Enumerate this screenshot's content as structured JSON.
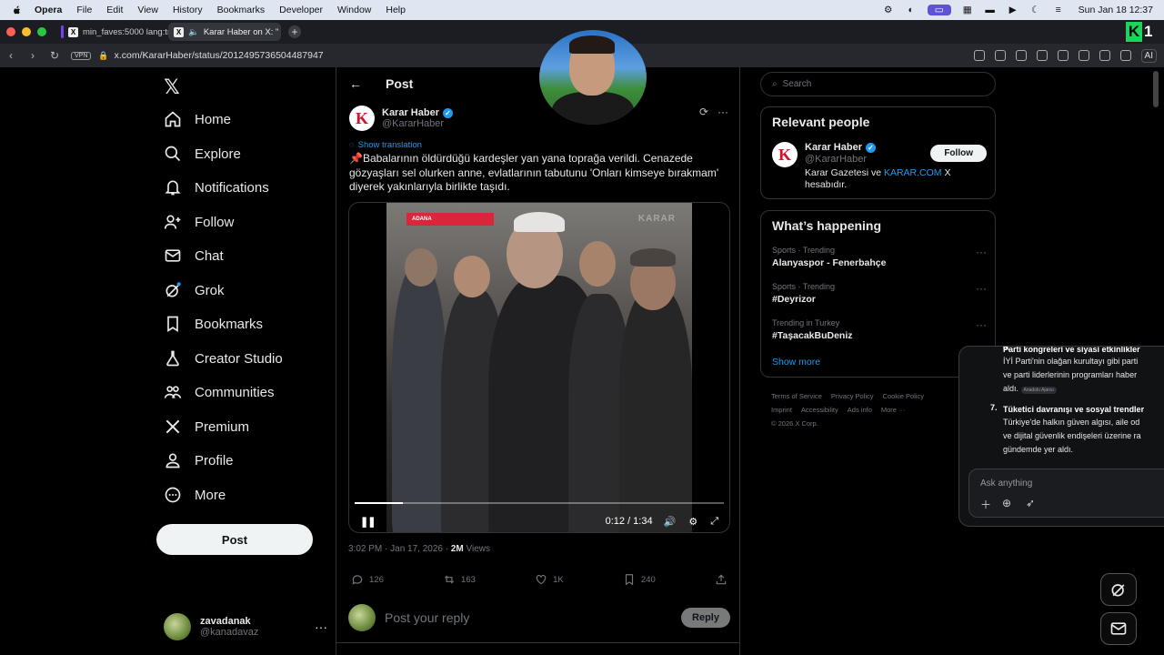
{
  "menubar": {
    "app": "Opera",
    "items": [
      "File",
      "Edit",
      "View",
      "History",
      "Bookmarks",
      "Developer",
      "Window",
      "Help"
    ],
    "clock": "Sun Jan 18  12:37"
  },
  "browser": {
    "tabs": [
      {
        "label": "min_faves:5000 lang:tr"
      },
      {
        "label": "Karar Haber on X: \""
      }
    ],
    "url": "x.com/KararHaber/status/2012495736504487947",
    "vpn": "VPN",
    "ai_label": "AI"
  },
  "nav": {
    "items": [
      {
        "label": "Home",
        "icon": "home-icon"
      },
      {
        "label": "Explore",
        "icon": "search-icon"
      },
      {
        "label": "Notifications",
        "icon": "bell-icon"
      },
      {
        "label": "Follow",
        "icon": "follow-icon"
      },
      {
        "label": "Chat",
        "icon": "mail-icon"
      },
      {
        "label": "Grok",
        "icon": "grok-icon"
      },
      {
        "label": "Bookmarks",
        "icon": "bookmark-icon"
      },
      {
        "label": "Creator Studio",
        "icon": "flask-icon"
      },
      {
        "label": "Communities",
        "icon": "communities-icon"
      },
      {
        "label": "Premium",
        "icon": "x-icon"
      },
      {
        "label": "Profile",
        "icon": "person-icon"
      },
      {
        "label": "More",
        "icon": "more-icon"
      }
    ],
    "post_button": "Post",
    "account": {
      "name": "zavadanak",
      "handle": "@kanadavaz"
    }
  },
  "post": {
    "header": "Post",
    "author_name": "Karar Haber",
    "author_handle": "@KararHaber",
    "show_translation": "Show translation",
    "text": "📌Babalarının öldürdüğü kardeşler yan yana toprağa verildi. Cenazede gözyaşları sel olurken anne, evlatlarının tabutunu 'Onları kimseye bırakmam' diyerek yakınlarıyla birlikte taşıdı.",
    "video": {
      "location_tag": "ADANA",
      "watermark": "KARAR",
      "time": "0:12 / 1:34",
      "progress": 0.13
    },
    "timestamp": "3:02 PM · Jan 17, 2026 · ",
    "views_count": "2M",
    "views_label": " Views",
    "stats": {
      "replies": "126",
      "reposts": "163",
      "likes": "1K",
      "bookmarks": "240"
    },
    "reply_placeholder": "Post your reply",
    "reply_button": "Reply"
  },
  "sidebar": {
    "search_placeholder": "Search",
    "relevant_title": "Relevant people",
    "relevant": {
      "name": "Karar Haber",
      "handle": "@KararHaber",
      "bio_pre": "Karar Gazetesi ve ",
      "bio_link": "KARAR.COM",
      "bio_post": " X hesabıdır.",
      "follow": "Follow"
    },
    "happening_title": "What’s happening",
    "trends": [
      {
        "category": "Sports · Trending",
        "title": "Alanyaspor - Fenerbahçe"
      },
      {
        "category": "Sports · Trending",
        "title": "#Deyrizor"
      },
      {
        "category": "Trending in Turkey",
        "title": "#TaşacakBuDeniz"
      }
    ],
    "show_more": "Show more",
    "footer": [
      "Terms of Service",
      "Privacy Policy",
      "Cookie Policy",
      "Imprint",
      "Accessibility",
      "Ads info",
      "More ···",
      "© 2026 X Corp."
    ]
  },
  "ai_panel": {
    "item6_title": "Parti kongreleri ve siyasi etkinlikler",
    "item6_lines": [
      "İYİ Parti'nin olağan kurultayı gibi parti",
      "ve parti liderlerinin programları haber",
      "aldı."
    ],
    "item6_source": "Anadolu Ajansı",
    "item7_num": "7.",
    "item6_num": "6.",
    "item7_title": "Tüketici davranışı ve sosyal trendler",
    "item7_lines": [
      "Türkiye'de halkın güven algısı, aile od",
      "ve dijital güvenlik endişeleri üzerine ra",
      "gündemde yer aldı."
    ],
    "ask_placeholder": "Ask anything"
  },
  "colors": {
    "accent": "#1d9bf0",
    "brand_red": "#d2112b",
    "background": "#000000"
  }
}
